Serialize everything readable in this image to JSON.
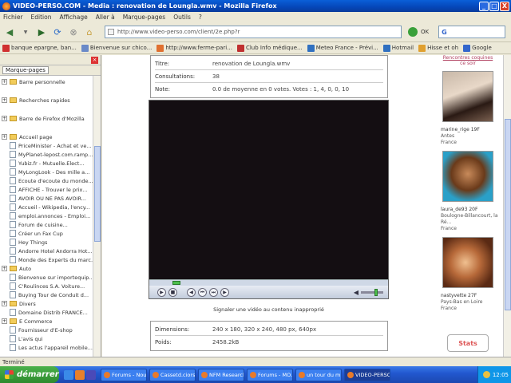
{
  "window": {
    "title": "VIDEO-PERSO.COM - Media : renovation de Loungla.wmv - Mozilla Firefox",
    "buttons": [
      "_",
      "□",
      "X"
    ]
  },
  "menubar": [
    "Fichier",
    "Edition",
    "Affichage",
    "Aller à",
    "Marque-pages",
    "Outils",
    "?"
  ],
  "navbar": {
    "url": "http://www.video-perso.com/client/2e.php?r",
    "go_label": "OK",
    "search_placeholder": "G"
  },
  "bookmarks": [
    {
      "label": "banque epargne, ban...",
      "color": "#d03030"
    },
    {
      "label": "Bienvenue sur chico...",
      "color": "#6a8ac8"
    },
    {
      "label": "http://www.ferme-pari...",
      "color": "#e07030"
    },
    {
      "label": "Club Info médique...",
      "color": "#c03030"
    },
    {
      "label": "Meteo France - Prévi...",
      "color": "#3070c0"
    },
    {
      "label": "Hotmail",
      "color": "#3070c0"
    },
    {
      "label": "Hisse et oh",
      "color": "#e0a030"
    },
    {
      "label": "Google",
      "color": "#3366cc"
    }
  ],
  "sidebar": {
    "title": "",
    "tab_label": "Marque-pages",
    "items": [
      {
        "type": "folder",
        "label": "Barre personnelle",
        "gap": false
      },
      {
        "type": "folder",
        "label": "Recherches rapides",
        "gap": true
      },
      {
        "type": "folder",
        "label": "Barre de Firefox d'Mozilla",
        "gap": true
      },
      {
        "type": "folder",
        "label": "Accueil page",
        "gap": true
      },
      {
        "type": "page",
        "label": "PriceMinister - Achat et ve..."
      },
      {
        "type": "page",
        "label": "MyPlanet-lepost.com.ramp..."
      },
      {
        "type": "page",
        "label": "Yubiz.fr - Mutuelle.Elect..."
      },
      {
        "type": "page",
        "label": "MyLongLook - Des mille a..."
      },
      {
        "type": "page",
        "label": "Ecoute d'ecoute du monde..."
      },
      {
        "type": "page",
        "label": "AFFICHE - Trouver le prix..."
      },
      {
        "type": "page",
        "label": "AVOIR OU NE PAS AVOIR..."
      },
      {
        "type": "page",
        "label": "Accueil - Wikipedia, l'ency..."
      },
      {
        "type": "page",
        "label": "emploi.annonces - Emploi..."
      },
      {
        "type": "page",
        "label": "Forum de cuisine..."
      },
      {
        "type": "page",
        "label": "Créer un Fax Cup"
      },
      {
        "type": "page",
        "label": "Hey Things"
      },
      {
        "type": "page",
        "label": "Andorre Hotel Andorra Hot..."
      },
      {
        "type": "page",
        "label": "Monde des Experts du marc..."
      },
      {
        "type": "folder",
        "label": "Auto",
        "gap": false
      },
      {
        "type": "page",
        "label": "Bienvenue sur importequip..."
      },
      {
        "type": "page",
        "label": "C'Roulinces S.A. Voiture..."
      },
      {
        "type": "page",
        "label": "Buying Tour de Conduit d..."
      },
      {
        "type": "folder",
        "label": "Divers",
        "gap": false
      },
      {
        "type": "page",
        "label": "Domaine Distrib FRANCE..."
      },
      {
        "type": "folder",
        "label": "E Commerce",
        "gap": false
      },
      {
        "type": "page",
        "label": "Fournisseur d'E-shop"
      },
      {
        "type": "page",
        "label": "L'avis qui"
      },
      {
        "type": "page",
        "label": "Les actus l'appareil mobile..."
      }
    ]
  },
  "info_top": [
    {
      "label": "Titre:",
      "value": "renovation de Loungla.wmv"
    },
    {
      "label": "Consultations:",
      "value": "38"
    },
    {
      "label": "Note:",
      "value": "0.0 de moyenne en 0 votes.    Votes : 1, 4, 0, 0, 10"
    }
  ],
  "player": {
    "seek_fraction": 0.1,
    "volume_fraction": 0.72
  },
  "caption": "Signaler une vidéo au contenu inapproprié",
  "info_bottom": [
    {
      "label": "Dimensions:",
      "value": "240 x 180, 320 x 240, 480 px, 640px"
    },
    {
      "label": "Poids:",
      "value": "2458.2kB"
    }
  ],
  "ads": {
    "header": "Rencontres coquines",
    "header2": "ce soir",
    "items": [
      {
        "name": "marine_rige 19F",
        "line2": "Antes",
        "line3": "France"
      },
      {
        "name": "laura_de93 20F",
        "line2": "Boulogne-Billancourt, la Ré...",
        "line3": "France"
      },
      {
        "name": "nastyvette 27F",
        "line2": "Pays-Bas en Loire",
        "line3": "France"
      }
    ],
    "stats_label": "Stats"
  },
  "status": "Terminé",
  "taskbar": {
    "start_label": "démarrer",
    "tasks": [
      {
        "label": "Forums - Nous...",
        "active": false
      },
      {
        "label": "Cassetd.ciorsi...",
        "active": false
      },
      {
        "label": "NFM Research...",
        "active": false
      },
      {
        "label": "Forums - MO...",
        "active": false
      },
      {
        "label": "un tour du m...",
        "active": false
      },
      {
        "label": "VIDEO-PERSO...",
        "active": true
      }
    ],
    "clock": "12:05"
  }
}
